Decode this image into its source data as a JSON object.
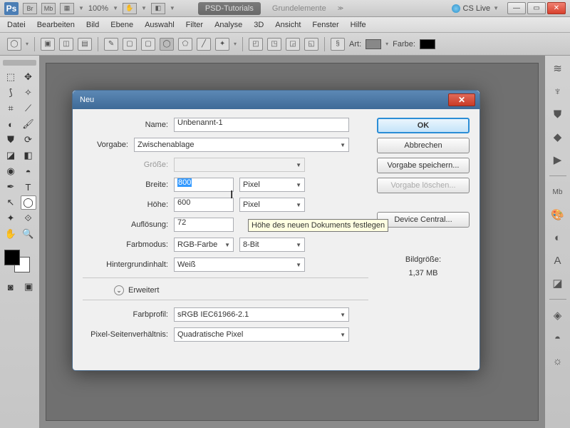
{
  "app": {
    "logo": "Ps",
    "br": "Br",
    "mb": "Mb",
    "zoom": "100%"
  },
  "tabs": {
    "active": "PSD-Tutorials",
    "inactive": "Grundelemente"
  },
  "cslive": "CS Live",
  "menubar": [
    "Datei",
    "Bearbeiten",
    "Bild",
    "Ebene",
    "Auswahl",
    "Filter",
    "Analyse",
    "3D",
    "Ansicht",
    "Fenster",
    "Hilfe"
  ],
  "optbar": {
    "art": "Art:",
    "farbe": "Farbe:"
  },
  "dialog": {
    "title": "Neu",
    "labels": {
      "name": "Name:",
      "vorgabe": "Vorgabe:",
      "groesse": "Größe:",
      "breite": "Breite:",
      "hoehe": "Höhe:",
      "aufloesung": "Auflösung:",
      "farbmodus": "Farbmodus:",
      "hintergrund": "Hintergrundinhalt:",
      "erweitert": "Erweitert",
      "farbprofil": "Farbprofil:",
      "pixelsv": "Pixel-Seitenverhältnis:"
    },
    "values": {
      "name": "Unbenannt-1",
      "vorgabe": "Zwischenablage",
      "breite": "800",
      "hoehe": "600",
      "aufloesung": "72",
      "farbmodus": "RGB-Farbe",
      "bit": "8-Bit",
      "hintergrund": "Weiß",
      "farbprofil": "sRGB IEC61966-2.1",
      "pixelsv": "Quadratische Pixel"
    },
    "units": {
      "breite": "Pixel",
      "hoehe": "Pixel"
    },
    "buttons": {
      "ok": "OK",
      "cancel": "Abbrechen",
      "save": "Vorgabe speichern...",
      "delete": "Vorgabe löschen...",
      "device": "Device Central..."
    },
    "info": {
      "label": "Bildgröße:",
      "value": "1,37 MB"
    },
    "tooltip": "Höhe des neuen Dokuments festlegen"
  }
}
